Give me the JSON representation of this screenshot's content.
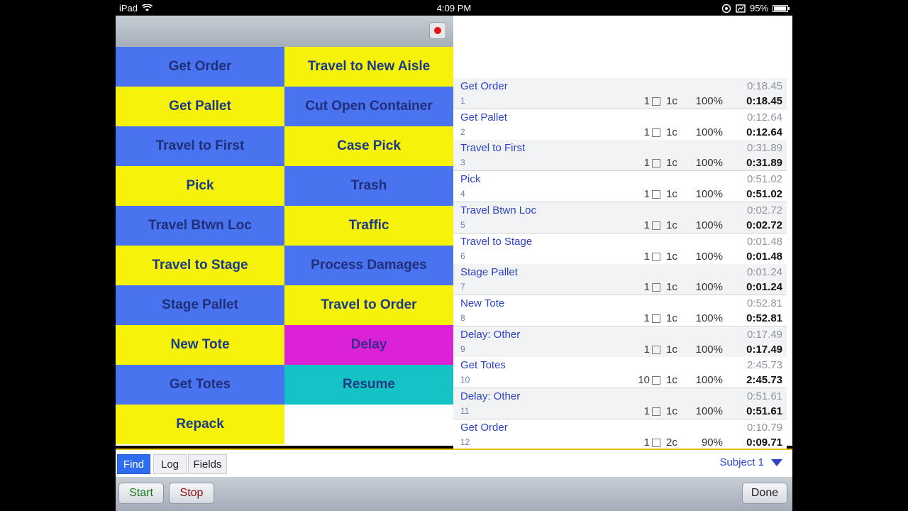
{
  "status_bar": {
    "device": "iPad",
    "time": "4:09 PM",
    "battery": "95%",
    "battery_level": 0.95
  },
  "grid": {
    "buttons": [
      {
        "label": "Get Order",
        "color": "#4a73f0"
      },
      {
        "label": "Travel to New Aisle",
        "color": "#f6f208"
      },
      {
        "label": "Get Pallet",
        "color": "#f6f208"
      },
      {
        "label": "Cut Open Container",
        "color": "#4a73f0"
      },
      {
        "label": "Travel to First",
        "color": "#4a73f0"
      },
      {
        "label": "Case Pick",
        "color": "#f6f208"
      },
      {
        "label": "Pick",
        "color": "#f6f208"
      },
      {
        "label": "Trash",
        "color": "#4a73f0"
      },
      {
        "label": "Travel Btwn Loc",
        "color": "#4a73f0"
      },
      {
        "label": "Traffic",
        "color": "#f6f208"
      },
      {
        "label": "Travel to Stage",
        "color": "#f6f208"
      },
      {
        "label": "Process Damages",
        "color": "#4a73f0"
      },
      {
        "label": "Stage Pallet",
        "color": "#4a73f0"
      },
      {
        "label": "Travel to Order",
        "color": "#f6f208"
      },
      {
        "label": "New Tote",
        "color": "#f6f208"
      },
      {
        "label": "Delay",
        "color": "#dc22d6"
      },
      {
        "label": "Get Totes",
        "color": "#4a73f0"
      },
      {
        "label": "Resume",
        "color": "#14c3c6"
      },
      {
        "label": "Repack",
        "color": "#f6f208"
      }
    ]
  },
  "log": {
    "rows": [
      {
        "name": "Get Order",
        "num": "1",
        "time_top": "0:18.45",
        "count": "1",
        "cycles": "1c",
        "pct": "100%",
        "time": "0:18.45"
      },
      {
        "name": "Get Pallet",
        "num": "2",
        "time_top": "0:12.64",
        "count": "1",
        "cycles": "1c",
        "pct": "100%",
        "time": "0:12.64"
      },
      {
        "name": "Travel to First",
        "num": "3",
        "time_top": "0:31.89",
        "count": "1",
        "cycles": "1c",
        "pct": "100%",
        "time": "0:31.89"
      },
      {
        "name": "Pick",
        "num": "4",
        "time_top": "0:51.02",
        "count": "1",
        "cycles": "1c",
        "pct": "100%",
        "time": "0:51.02"
      },
      {
        "name": "Travel Btwn Loc",
        "num": "5",
        "time_top": "0:02.72",
        "count": "1",
        "cycles": "1c",
        "pct": "100%",
        "time": "0:02.72"
      },
      {
        "name": "Travel to Stage",
        "num": "6",
        "time_top": "0:01.48",
        "count": "1",
        "cycles": "1c",
        "pct": "100%",
        "time": "0:01.48"
      },
      {
        "name": "Stage Pallet",
        "num": "7",
        "time_top": "0:01.24",
        "count": "1",
        "cycles": "1c",
        "pct": "100%",
        "time": "0:01.24"
      },
      {
        "name": "New Tote",
        "num": "8",
        "time_top": "0:52.81",
        "count": "1",
        "cycles": "1c",
        "pct": "100%",
        "time": "0:52.81"
      },
      {
        "name": "Delay: Other",
        "num": "9",
        "time_top": "0:17.49",
        "count": "1",
        "cycles": "1c",
        "pct": "100%",
        "time": "0:17.49"
      },
      {
        "name": "Get Totes",
        "num": "10",
        "time_top": "2:45.73",
        "count": "10",
        "cycles": "1c",
        "pct": "100%",
        "time": "2:45.73"
      },
      {
        "name": "Delay: Other",
        "num": "11",
        "time_top": "0:51.61",
        "count": "1",
        "cycles": "1c",
        "pct": "100%",
        "time": "0:51.61"
      },
      {
        "name": "Get Order",
        "num": "12",
        "time_top": "0:10.79",
        "count": "1",
        "cycles": "2c",
        "pct": "90%",
        "time": "0:09.71"
      }
    ]
  },
  "tabs": {
    "find": "Find",
    "log": "Log",
    "fields": "Fields"
  },
  "subject": {
    "label": "Subject 1"
  },
  "bottom": {
    "start": "Start",
    "stop": "Stop",
    "done": "Done"
  },
  "colors": {
    "start_text": "#1a7a1a",
    "stop_text": "#8a1010",
    "link": "#2d43c8"
  }
}
